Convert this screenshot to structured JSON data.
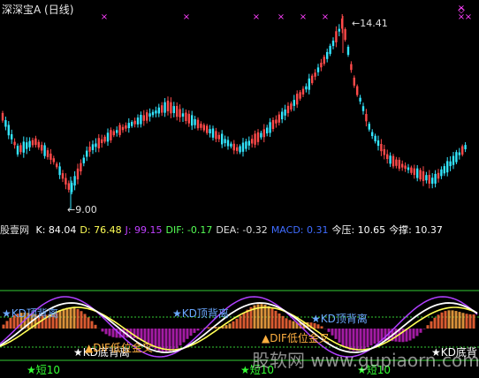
{
  "header": {
    "title": "深深宝A (日线)",
    "high_label": "14.41",
    "low_label": "9.00"
  },
  "indicator_bar": {
    "name": "股壹网",
    "items": [
      {
        "label": "K:",
        "value": "84.04",
        "color": "#ffffff"
      },
      {
        "label": "D:",
        "value": "76.48",
        "color": "#ffff55"
      },
      {
        "label": "J:",
        "value": "99.15",
        "color": "#c040ff"
      },
      {
        "label": "DIF:",
        "value": "-0.17",
        "color": "#55ff55"
      },
      {
        "label": "DEA:",
        "value": "-0.32",
        "color": "#dddddd"
      },
      {
        "label": "MACD:",
        "value": "0.31",
        "color": "#3f6cff"
      },
      {
        "label": "今压:",
        "value": "10.65",
        "color": "#ffffff"
      },
      {
        "label": "今撑:",
        "value": "10.37",
        "color": "#ffffff"
      }
    ]
  },
  "signals": {
    "kd_top_divergence": "KD顶背离",
    "kd_bottom_divergence": "KD底背离",
    "dif_low_golden_cross": "DIF低位金叉",
    "short10": "短10",
    "kd_bottom_divergence_cut": "KD底背"
  },
  "watermark": "股软网 www.gupiaorn.com",
  "colors": {
    "up": "#ff4a4a",
    "down": "#33e6ff",
    "marker": "#ff40ff",
    "k_line": "#ffffff",
    "d_line": "#ffff55",
    "j_line": "#b040ff",
    "guide": "#33cc33"
  }
}
